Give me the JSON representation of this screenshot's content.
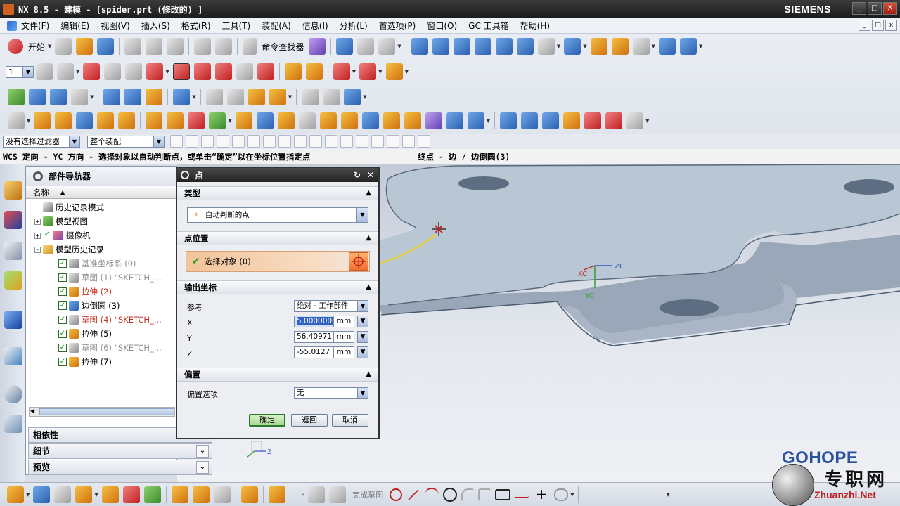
{
  "window": {
    "title": "NX 8.5 - 建模 - [spider.prt  (修改的) ]",
    "brand": "SIEMENS",
    "buttons": {
      "minimize": "_",
      "maximize": "□",
      "close": "X"
    }
  },
  "menubar": {
    "items": [
      "文件(F)",
      "编辑(E)",
      "视图(V)",
      "插入(S)",
      "格式(R)",
      "工具(T)",
      "装配(A)",
      "信息(I)",
      "分析(L)",
      "首选项(P)",
      "窗口(O)",
      "GC 工具箱",
      "帮助(H)"
    ]
  },
  "toolbar": {
    "start_label": "开始",
    "command_finder_label": "命令查找器",
    "layer_value": "1"
  },
  "selection_bar": {
    "filter_value": "没有选择过滤器",
    "scope_value": "整个装配"
  },
  "cue_line": {
    "prompt": "WCS 定向 - YC 方向 - 选择对象以自动判断点，或单击“确定”以在坐标位置指定点",
    "status": "终点 - 边 / 边倒圆(3)"
  },
  "part_navigator": {
    "title": "部件导航器",
    "column_name": "名称",
    "items": [
      {
        "label": "历史记录模式",
        "type": "clock",
        "expand": "",
        "check": false,
        "style": ""
      },
      {
        "label": "模型视图",
        "type": "view",
        "expand": "+",
        "check": false,
        "style": ""
      },
      {
        "label": "摄像机",
        "type": "camera",
        "expand": "+",
        "check": true,
        "style": ""
      },
      {
        "label": "模型历史记录",
        "type": "folder",
        "expand": "-",
        "check": false,
        "style": ""
      },
      {
        "label": "基准坐标系 (0)",
        "type": "csys",
        "expand": "",
        "check": true,
        "style": "gray"
      },
      {
        "label": "草图 (1) \"SKETCH_...",
        "type": "sketch",
        "expand": "",
        "check": true,
        "style": "gray"
      },
      {
        "label": "拉伸 (2)",
        "type": "extrude",
        "expand": "",
        "check": true,
        "style": "red"
      },
      {
        "label": "边倒圆 (3)",
        "type": "blend",
        "expand": "",
        "check": true,
        "style": ""
      },
      {
        "label": "草图 (4) \"SKETCH_...",
        "type": "sketch",
        "expand": "",
        "check": true,
        "style": "red"
      },
      {
        "label": "拉伸 (5)",
        "type": "extrude",
        "expand": "",
        "check": true,
        "style": ""
      },
      {
        "label": "草图 (6) \"SKETCH_...",
        "type": "sketch",
        "expand": "",
        "check": true,
        "style": "gray"
      },
      {
        "label": "拉伸 (7)",
        "type": "extrude",
        "expand": "",
        "check": true,
        "style": ""
      }
    ],
    "panels": [
      "相依性",
      "细节",
      "预览"
    ]
  },
  "point_dialog": {
    "title": "点",
    "groups": {
      "type": "类型",
      "point_location": "点位置",
      "output_coords": "输出坐标",
      "offset": "偏置"
    },
    "type_value": "自动判断的点",
    "select_object_label": "选择对象 (0)",
    "reference_label": "参考",
    "reference_value": "绝对 - 工作部件",
    "x_label": "X",
    "x_value": "5.0000000",
    "y_label": "Y",
    "y_value": "56.40971",
    "z_label": "Z",
    "z_value": "-55.0127",
    "unit": "mm",
    "offset_label": "偏置选项",
    "offset_value": "无",
    "buttons": {
      "ok": "确定",
      "back": "返回",
      "cancel": "取消"
    }
  },
  "graphics": {
    "wcs_labels": {
      "xc": "XC",
      "yc": "YC",
      "zc": "ZC"
    },
    "triad_z": "Z"
  },
  "bottom_toolbar": {
    "finish_sketch": "完成草图"
  },
  "watermark": {
    "logo": "GOHOPE",
    "chinese": "专职网",
    "url": "Zhuanzhi.Net"
  }
}
